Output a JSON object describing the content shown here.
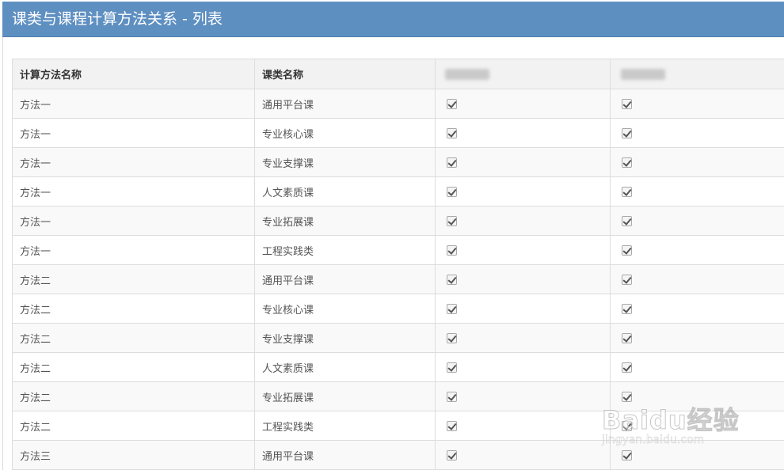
{
  "window": {
    "title": "课类与课程计算方法关系 - 列表"
  },
  "table": {
    "headers": [
      "计算方法名称",
      "课类名称",
      "",
      ""
    ],
    "rows": [
      {
        "method": "方法一",
        "course_type": "通用平台课",
        "col3_checked": true,
        "col4_checked": true
      },
      {
        "method": "方法一",
        "course_type": "专业核心课",
        "col3_checked": true,
        "col4_checked": true
      },
      {
        "method": "方法一",
        "course_type": "专业支撑课",
        "col3_checked": true,
        "col4_checked": true
      },
      {
        "method": "方法一",
        "course_type": "人文素质课",
        "col3_checked": true,
        "col4_checked": true
      },
      {
        "method": "方法一",
        "course_type": "专业拓展课",
        "col3_checked": true,
        "col4_checked": true
      },
      {
        "method": "方法一",
        "course_type": "工程实践类",
        "col3_checked": true,
        "col4_checked": true
      },
      {
        "method": "方法二",
        "course_type": "通用平台课",
        "col3_checked": true,
        "col4_checked": true
      },
      {
        "method": "方法二",
        "course_type": "专业核心课",
        "col3_checked": true,
        "col4_checked": true
      },
      {
        "method": "方法二",
        "course_type": "专业支撑课",
        "col3_checked": true,
        "col4_checked": true
      },
      {
        "method": "方法二",
        "course_type": "人文素质课",
        "col3_checked": true,
        "col4_checked": true
      },
      {
        "method": "方法二",
        "course_type": "专业拓展课",
        "col3_checked": true,
        "col4_checked": true
      },
      {
        "method": "方法二",
        "course_type": "工程实践类",
        "col3_checked": true,
        "col4_checked": true
      },
      {
        "method": "方法三",
        "course_type": "通用平台课",
        "col3_checked": true,
        "col4_checked": true
      }
    ]
  },
  "watermark": {
    "brand": "Baidu经验",
    "url": "jingyan.baidu.com"
  },
  "colors": {
    "titlebar": "#5e8fc1",
    "header_bg": "#f2f2f2",
    "row_alt_bg": "#f9f9f9",
    "border": "#dddddd"
  }
}
